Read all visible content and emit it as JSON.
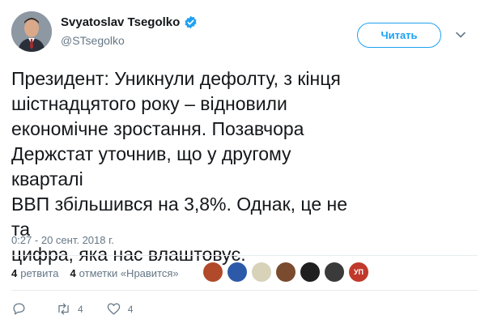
{
  "profile": {
    "name": "Svyatoslav Tsegolko",
    "handle": "@STsegolko",
    "verified": true
  },
  "follow_button": {
    "label": "Читать"
  },
  "tweet": {
    "text_lines": [
      "Президент: Уникнули дефолту, з кінця",
      "шістнадцятого року – відновили",
      "економічне зростання. Позавчора",
      "Держстат уточнив, що у другому кварталі",
      "ВВП збільшився на 3,8%. Однак, це не та",
      "цифра, яка нас влаштовує."
    ],
    "timestamp": "0:27 - 20 сент. 2018 г."
  },
  "stats": {
    "retweets_count": "4",
    "retweets_label": "ретвита",
    "likes_count": "4",
    "likes_label": "отметки «Нравится»"
  },
  "liker_avatars": [
    {
      "name": "liker-avatar-1",
      "bg": "#b04a2a",
      "label": ""
    },
    {
      "name": "liker-avatar-2",
      "bg": "#2d5aa8",
      "label": ""
    },
    {
      "name": "liker-avatar-3",
      "bg": "#d8d2b8",
      "label": ""
    },
    {
      "name": "liker-avatar-4",
      "bg": "#7a4b2f",
      "label": ""
    },
    {
      "name": "liker-avatar-5",
      "bg": "#1f1f1f",
      "label": ""
    },
    {
      "name": "liker-avatar-6",
      "bg": "#3a3a3a",
      "label": ""
    },
    {
      "name": "liker-avatar-7",
      "bg": "#c0392b",
      "label": "УП"
    }
  ],
  "actions": {
    "reply": {
      "icon": "reply-icon",
      "count": ""
    },
    "retweet": {
      "icon": "retweet-icon",
      "count": "4"
    },
    "like": {
      "icon": "heart-icon",
      "count": "4"
    }
  },
  "colors": {
    "accent": "#1da1f2",
    "secondary_text": "#657786",
    "divider": "#e6ecf0"
  }
}
